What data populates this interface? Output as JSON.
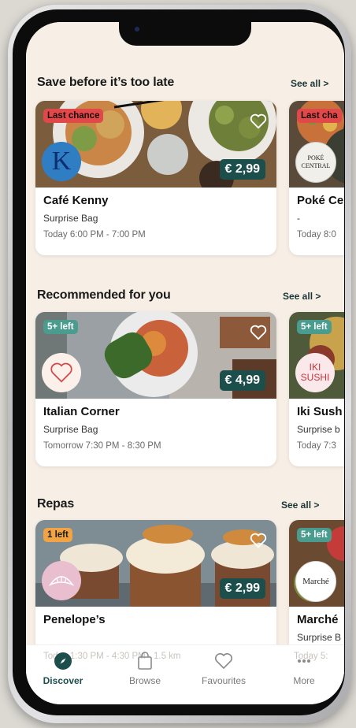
{
  "sections": [
    {
      "title": "Save before it’s too late",
      "see_all": "See all >",
      "cards": [
        {
          "badge": "Last chance",
          "price": "€ 2,99",
          "name": "Café Kenny",
          "bag": "Surprise Bag",
          "pickup": "Today 6:00 PM - 7:00 PM",
          "logo_text": "K"
        },
        {
          "badge": "Last cha",
          "name": "Poké Ce",
          "bag": "-",
          "pickup": "Today 8:0",
          "logo_text": "POKÉ CENTRAL"
        }
      ]
    },
    {
      "title": "Recommended for you",
      "see_all": "See all >",
      "cards": [
        {
          "badge": "5+ left",
          "price": "€ 4,99",
          "name": "Italian Corner",
          "bag": "Surprise Bag",
          "pickup": "Tomorrow 7:30 PM - 8:30 PM"
        },
        {
          "badge": "5+ left",
          "name": "Iki Sush",
          "bag": "Surprise b",
          "pickup": "Today 7:3",
          "logo_text": "IKI SUSHI"
        }
      ]
    },
    {
      "title": "Repas",
      "see_all": "See all >",
      "cards": [
        {
          "badge": "1 left",
          "price": "€ 2,99",
          "name": "Penelope’s",
          "pickup": "Today 1:30 PM - 4:30 PM · 1.5 km"
        },
        {
          "badge": "5+ left",
          "name": "Marché",
          "bag": "Surprise B",
          "pickup": "Today 5:",
          "logo_text": "Marché"
        }
      ]
    }
  ],
  "tabs": [
    {
      "label": "Discover",
      "icon": "compass-icon",
      "active": true
    },
    {
      "label": "Browse",
      "icon": "bag-icon",
      "active": false
    },
    {
      "label": "Favourites",
      "icon": "heart-icon",
      "active": false
    },
    {
      "label": "More",
      "icon": "more-dots-icon",
      "active": false
    }
  ],
  "colors": {
    "screen_bg": "#f7efe6",
    "price_bg": "#1c4e4c",
    "badge_red": "#e0484a",
    "badge_teal": "#4a9c8f",
    "badge_orange": "#f2a445",
    "accent": "#1c4e4c"
  }
}
